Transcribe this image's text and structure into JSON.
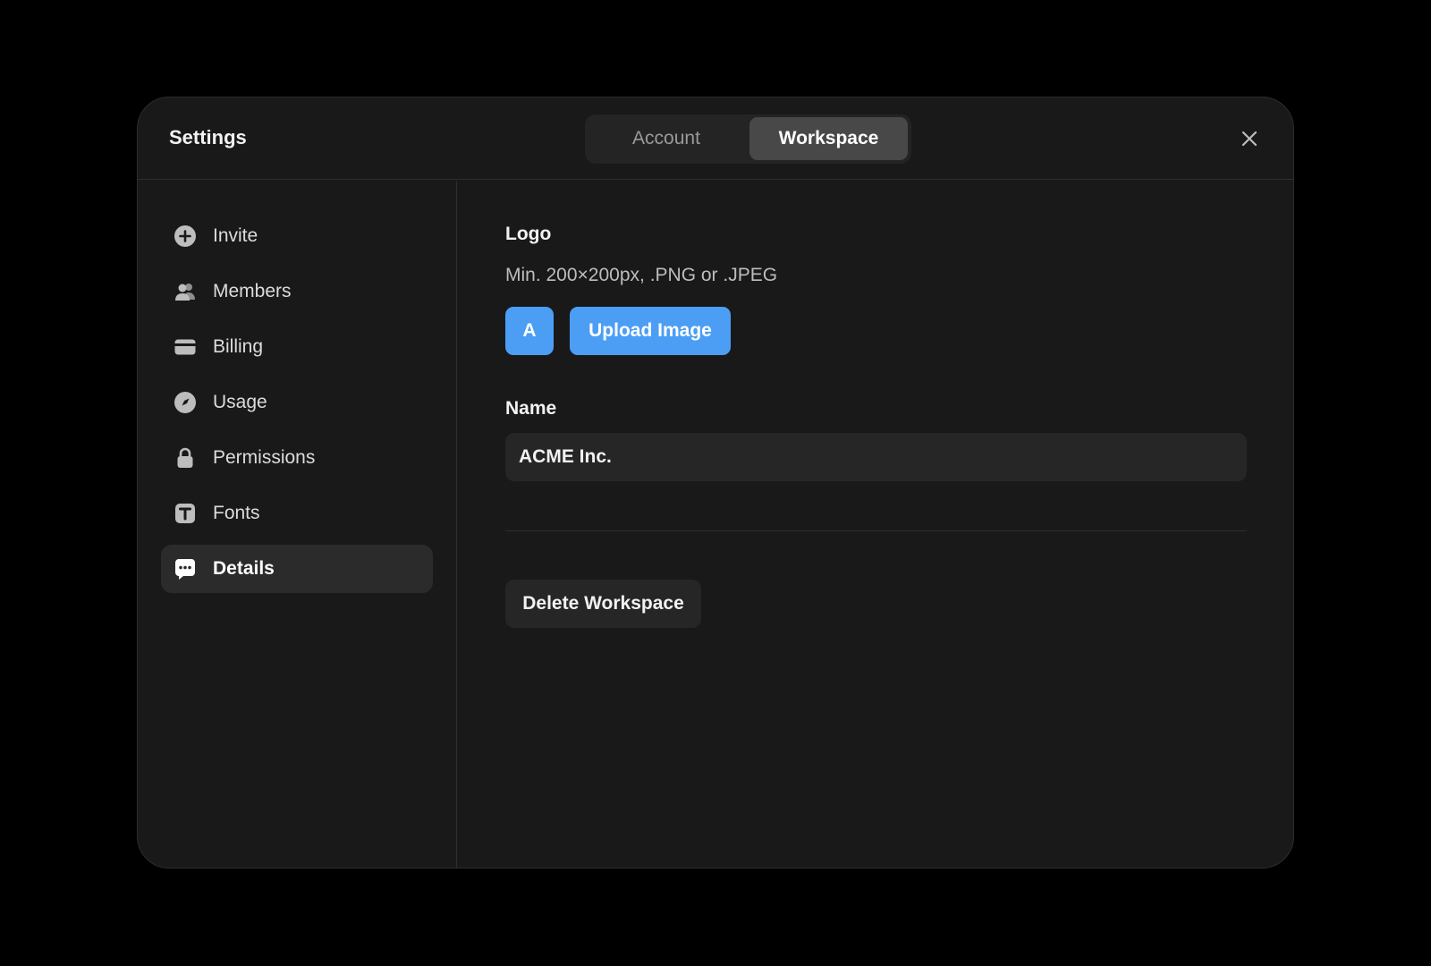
{
  "dialog": {
    "title": "Settings",
    "tabs": [
      {
        "label": "Account",
        "active": false
      },
      {
        "label": "Workspace",
        "active": true
      }
    ],
    "close_icon": "close-icon"
  },
  "sidebar": {
    "items": [
      {
        "label": "Invite",
        "icon": "plus-circle-icon",
        "active": false
      },
      {
        "label": "Members",
        "icon": "users-icon",
        "active": false
      },
      {
        "label": "Billing",
        "icon": "credit-card-icon",
        "active": false
      },
      {
        "label": "Usage",
        "icon": "gauge-icon",
        "active": false
      },
      {
        "label": "Permissions",
        "icon": "lock-icon",
        "active": false
      },
      {
        "label": "Fonts",
        "icon": "type-icon",
        "active": false
      },
      {
        "label": "Details",
        "icon": "chat-dots-icon",
        "active": true
      }
    ]
  },
  "main": {
    "logo": {
      "label": "Logo",
      "hint": "Min. 200×200px, .PNG or .JPEG",
      "avatar_letter": "A",
      "upload_label": "Upload Image"
    },
    "name": {
      "label": "Name",
      "value": "ACME Inc."
    },
    "delete_label": "Delete Workspace"
  },
  "colors": {
    "accent": "#4c9ef5",
    "panel": "#191919",
    "backdrop": "#000000"
  }
}
